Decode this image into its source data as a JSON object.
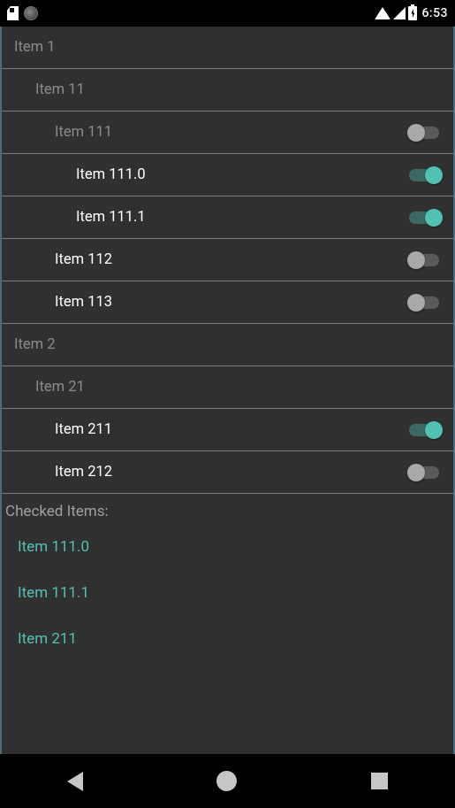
{
  "status": {
    "time": "6:53"
  },
  "tree": [
    {
      "type": "header",
      "level": 0,
      "label": "Item 1"
    },
    {
      "type": "header",
      "level": 1,
      "label": "Item 11"
    },
    {
      "type": "switch",
      "level": 2,
      "label": "Item 111",
      "on": false,
      "header_style": true
    },
    {
      "type": "switch",
      "level": 3,
      "label": "Item 111.0",
      "on": true
    },
    {
      "type": "switch",
      "level": 3,
      "label": "Item 111.1",
      "on": true
    },
    {
      "type": "switch",
      "level": 2,
      "label": "Item 112",
      "on": false
    },
    {
      "type": "switch",
      "level": 2,
      "label": "Item 113",
      "on": false
    },
    {
      "type": "header",
      "level": 0,
      "label": "Item 2"
    },
    {
      "type": "header",
      "level": 1,
      "label": "Item 21"
    },
    {
      "type": "switch",
      "level": 2,
      "label": "Item 211",
      "on": true
    },
    {
      "type": "switch",
      "level": 2,
      "label": "Item 212",
      "on": false
    }
  ],
  "checked_title": "Checked Items:",
  "checked_items": [
    "Item 111.0",
    "Item 111.1",
    "Item 211"
  ]
}
